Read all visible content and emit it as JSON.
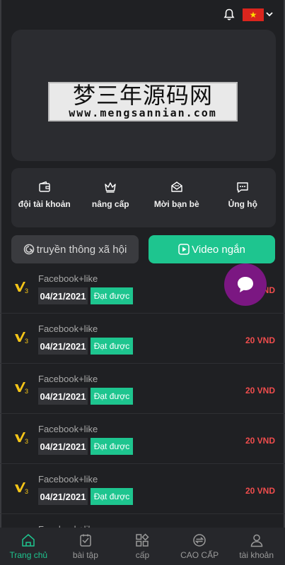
{
  "header": {
    "language_flag": "vietnam-flag-icon",
    "flag_star": "★"
  },
  "banner": {
    "watermark_cn": "梦三年源码网",
    "watermark_url": "www.mengsannian.com"
  },
  "quick_actions": [
    {
      "label": "đội tài khoản",
      "icon": "wallet-icon"
    },
    {
      "label": "nâng cấp",
      "icon": "crown-icon"
    },
    {
      "label": "Mời bạn bè",
      "icon": "invite-mail-icon"
    },
    {
      "label": "Ủng hộ",
      "icon": "chat-support-icon"
    }
  ],
  "tabs": {
    "social": "truyền thông xã hội",
    "video": "Video ngắn"
  },
  "tasks": [
    {
      "title": "Facebook+like",
      "date": "04/21/2021",
      "status": "Đạt được",
      "amount": "20 VND"
    },
    {
      "title": "Facebook+like",
      "date": "04/21/2021",
      "status": "Đạt được",
      "amount": "20 VND"
    },
    {
      "title": "Facebook+like",
      "date": "04/21/2021",
      "status": "Đạt được",
      "amount": "20 VND"
    },
    {
      "title": "Facebook+like",
      "date": "04/21/2021",
      "status": "Đạt được",
      "amount": "20 VND"
    },
    {
      "title": "Facebook+like",
      "date": "04/21/2021",
      "status": "Đạt được",
      "amount": "20 VND"
    },
    {
      "title": "Facebook+like"
    }
  ],
  "vip_badge": "3",
  "bottom_nav": [
    {
      "label": "Trang chủ",
      "icon": "home-icon",
      "active": true
    },
    {
      "label": "bài tập",
      "icon": "task-icon"
    },
    {
      "label": "cấp",
      "icon": "grid-icon"
    },
    {
      "label": "CAO CẤP",
      "icon": "exchange-icon"
    },
    {
      "label": "tài khoản",
      "icon": "user-icon"
    }
  ],
  "colors": {
    "accent": "#1ec58f",
    "amount": "#f04d4d",
    "chat_bubble": "#7b1782",
    "background": "#1f2023"
  }
}
